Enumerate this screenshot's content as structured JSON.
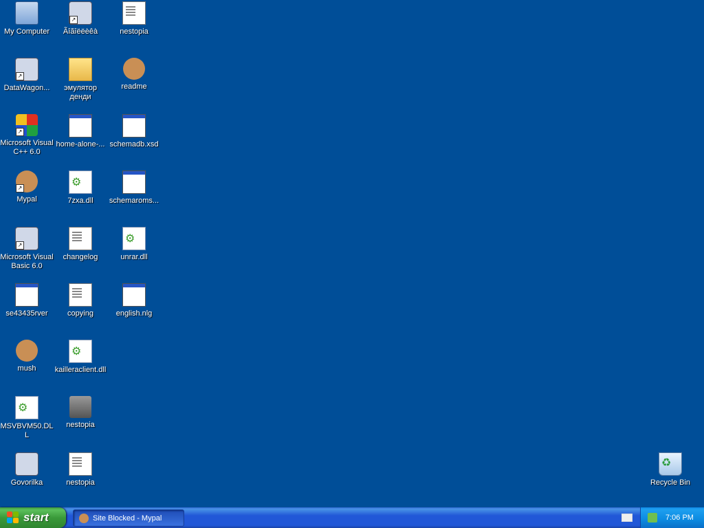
{
  "desktop": {
    "icons": [
      {
        "label": "My Computer"
      },
      {
        "label": "Ãîãîëëèêà"
      },
      {
        "label": "nestopia"
      },
      {
        "label": "DataWagon..."
      },
      {
        "label": "эмулятор денди"
      },
      {
        "label": "readme"
      },
      {
        "label": "Microsoft Visual C++ 6.0"
      },
      {
        "label": "home-alone-..."
      },
      {
        "label": "schemadb.xsd"
      },
      {
        "label": "Mypal"
      },
      {
        "label": "7zxa.dll"
      },
      {
        "label": "schemaroms..."
      },
      {
        "label": "Microsoft Visual Basic 6.0"
      },
      {
        "label": "changelog"
      },
      {
        "label": "unrar.dll"
      },
      {
        "label": "se43435rver"
      },
      {
        "label": "copying"
      },
      {
        "label": "english.nlg"
      },
      {
        "label": "mush"
      },
      {
        "label": "kailleraclient.dll"
      },
      {
        "label": "MSVBVM50.DLL"
      },
      {
        "label": "nestopia"
      },
      {
        "label": "Govorilka"
      },
      {
        "label": "nestopia"
      },
      {
        "label": "Recycle Bin"
      }
    ]
  },
  "taskbar": {
    "start_label": "start",
    "task_label": "Site Blocked - Mypal",
    "clock": "7:06 PM"
  },
  "colors": {
    "desktop_bg": "#004e98",
    "taskbar": "#2157d7",
    "start": "#3a9a3a"
  }
}
